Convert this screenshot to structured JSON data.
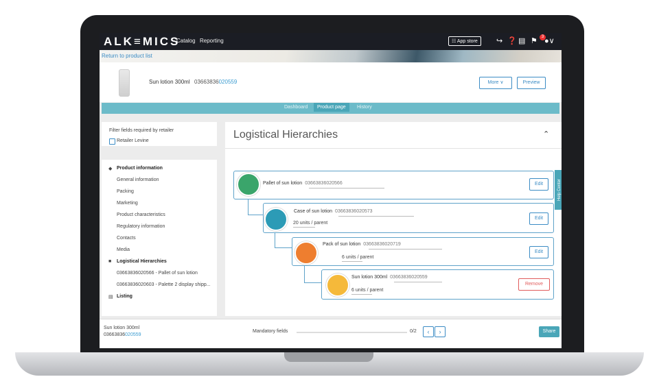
{
  "topbar": {
    "logo": "ALK≡MICS",
    "nav": [
      "Catalog",
      "Reporting"
    ],
    "app_store_label": "☷ App store",
    "notification_count": "3"
  },
  "return_link": "Return to product list",
  "product": {
    "name": "Sun lotion 300ml",
    "gtin_prefix": "03663836",
    "gtin_highlight": "020559",
    "more_label": "More ∨",
    "preview_label": "Preview"
  },
  "tabs": [
    "Dashboard",
    "Product page",
    "History"
  ],
  "filter": {
    "title": "Filter fields required by retailer",
    "retailer": "Retailer Levine"
  },
  "sidebar": {
    "product_info_title": "Product information",
    "product_info_items": [
      "General information",
      "Packing",
      "Marketing",
      "Product characteristics",
      "Regulatory information",
      "Contacts",
      "Media"
    ],
    "logistical_title": "Logistical Hierarchies",
    "logistical_items": [
      "03663836020566 - Pallet of sun lotion",
      "03663836020603 - Palette 2 display shipp..."
    ],
    "listing_title": "Listing"
  },
  "main": {
    "title": "Logistical Hierarchies",
    "hierarchy": [
      {
        "name": "Pallet of sun lotion",
        "gtin": "03663836020566",
        "units": "",
        "action": "Edit",
        "color": "#3aa56b"
      },
      {
        "name": "Case of sun lotion",
        "gtin": "03663836020573",
        "units": "20",
        "action": "Edit",
        "color": "#2c9bb6"
      },
      {
        "name": "Pack of sun lotion",
        "gtin": "03663836020719",
        "units": "6",
        "action": "Edit",
        "color": "#ee7e2f"
      },
      {
        "name": "Sun lotion 300ml",
        "gtin": "03663836020559",
        "units": "6",
        "action": "Remove",
        "color": "#f5b93a"
      }
    ],
    "units_suffix": "units / parent"
  },
  "help_center": "Help Center",
  "footer": {
    "product_name": "Sun lotion 300ml",
    "gtin_prefix": "03663836",
    "gtin_highlight": "020559",
    "mandatory_label": "Mandatory fields",
    "mandatory_count": "0/2",
    "share_label": "Share"
  }
}
